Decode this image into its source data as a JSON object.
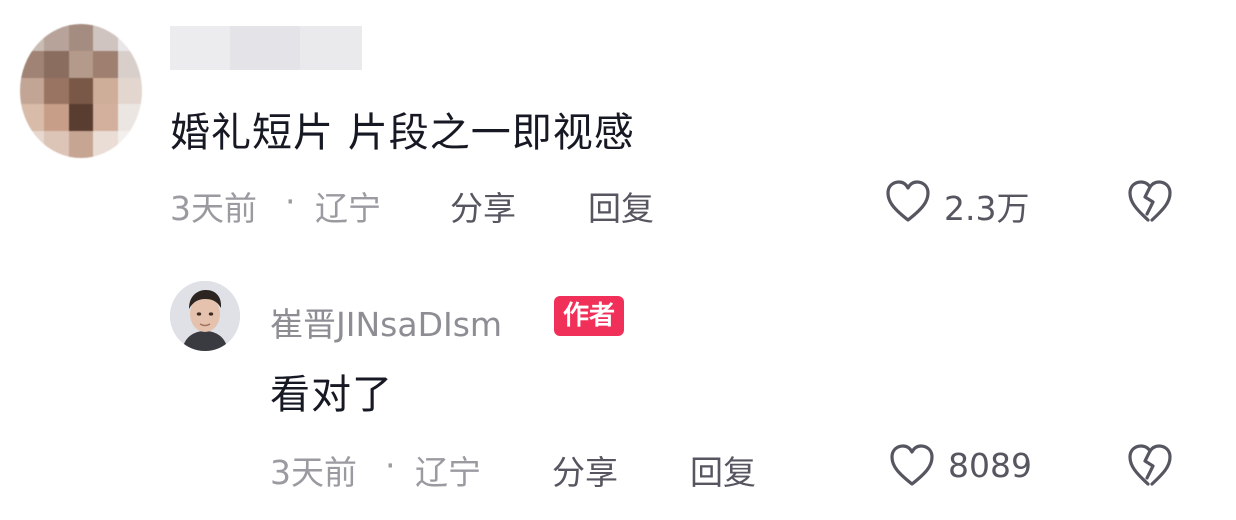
{
  "comment": {
    "text": "婚礼短片 片段之一即视感",
    "time": "3天前",
    "separator": "·",
    "location": "辽宁",
    "share_label": "分享",
    "reply_label": "回复",
    "like_count": "2.3万",
    "like_icon": "heart-outline-icon",
    "dislike_icon": "broken-heart-icon"
  },
  "reply": {
    "username": "崔晋JINsaDIsm",
    "badge": "作者",
    "text": "看对了",
    "time": "3天前",
    "separator": "·",
    "location": "辽宁",
    "share_label": "分享",
    "reply_label": "回复",
    "like_count": "8089",
    "like_icon": "heart-outline-icon",
    "dislike_icon": "broken-heart-icon"
  },
  "colors": {
    "text_primary": "#161823",
    "text_meta": "#9a9aa1",
    "badge_bg": "#f1305a"
  }
}
